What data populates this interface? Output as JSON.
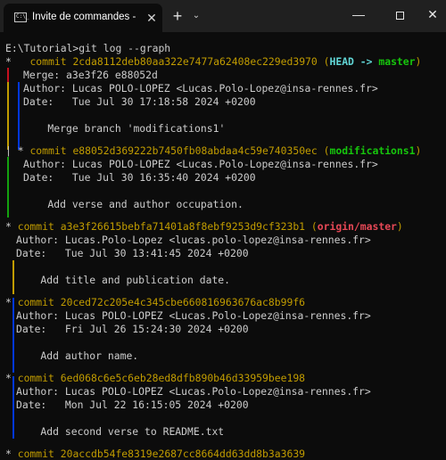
{
  "window": {
    "tab_icon_text": "C:\\_",
    "tab_title": "Invite de commandes - git  log",
    "tab_close": "✕",
    "new_tab": "+",
    "dropdown": "⌄",
    "minimize": "—",
    "close": "✕"
  },
  "colors": {
    "background": "#0c0c0c",
    "titlebar": "#202020",
    "commit_hash": "#c19c00",
    "head": "#61d6d6",
    "branch": "#16c60c",
    "origin": "#e74856",
    "graph_yellow": "#c19c00",
    "graph_blue": "#0037da",
    "graph_green": "#13a10e",
    "graph_red": "#c50f1f"
  },
  "terminal": {
    "prompt": "E:\\Tutorial>git log --graph",
    "commits": [
      {
        "prefix": "*   ",
        "label": "commit ",
        "hash": "2cda8112deb80aa322e7477a62408ec229ed3970",
        "ref_open": " (",
        "ref_head": "HEAD -> ",
        "ref_branch": "master",
        "ref_close": ")",
        "merge": "Merge: a3e3f26 e88052d",
        "author": "Author: Lucas POLO-LOPEZ <Lucas.Polo-Lopez@insa-rennes.fr>",
        "date": "Date:   Tue Jul 30 17:18:58 2024 +0200",
        "message": "    Merge branch 'modifications1'"
      },
      {
        "prefix": "| * ",
        "label": "commit ",
        "hash": "e88052d369222b7450fb08abdaa4c59e740350ec",
        "ref_open": " (",
        "ref_branch": "modifications1",
        "ref_close": ")",
        "author": "Author: Lucas POLO-LOPEZ <Lucas.Polo-Lopez@insa-rennes.fr>",
        "date": "Date:   Tue Jul 30 16:35:40 2024 +0200",
        "message": "    Add verse and author occupation."
      },
      {
        "prefix": "* ",
        "label": "commit ",
        "hash": "a3e3f26615bebfa71401a8f8ebf9253d9cf323b1",
        "ref_open": " (",
        "ref_origin": "origin/master",
        "ref_close": ")",
        "author": "Author: Lucas.Polo-Lopez <lucas.polo-lopez@insa-rennes.fr>",
        "date": "Date:   Tue Jul 30 13:41:45 2024 +0200",
        "message": "    Add title and publication date."
      },
      {
        "prefix": "* ",
        "label": "commit ",
        "hash": "20ced72c205e4c345cbe660816963676ac8b99f6",
        "author": "Author: Lucas POLO-LOPEZ <Lucas.Polo-Lopez@insa-rennes.fr>",
        "date": "Date:   Fri Jul 26 15:24:30 2024 +0200",
        "message": "    Add author name."
      },
      {
        "prefix": "* ",
        "label": "commit ",
        "hash": "6ed068c6e5c6eb28ed8dfb890b46d33959bee198",
        "author": "Author: Lucas POLO-LOPEZ <Lucas.Polo-Lopez@insa-rennes.fr>",
        "date": "Date:   Mon Jul 22 16:15:05 2024 +0200",
        "message": "    Add second verse to README.txt"
      },
      {
        "prefix": "* ",
        "label": "commit ",
        "hash": "20accdb54fe8319e2687cc8664dd63dd8b3a3639"
      }
    ]
  }
}
